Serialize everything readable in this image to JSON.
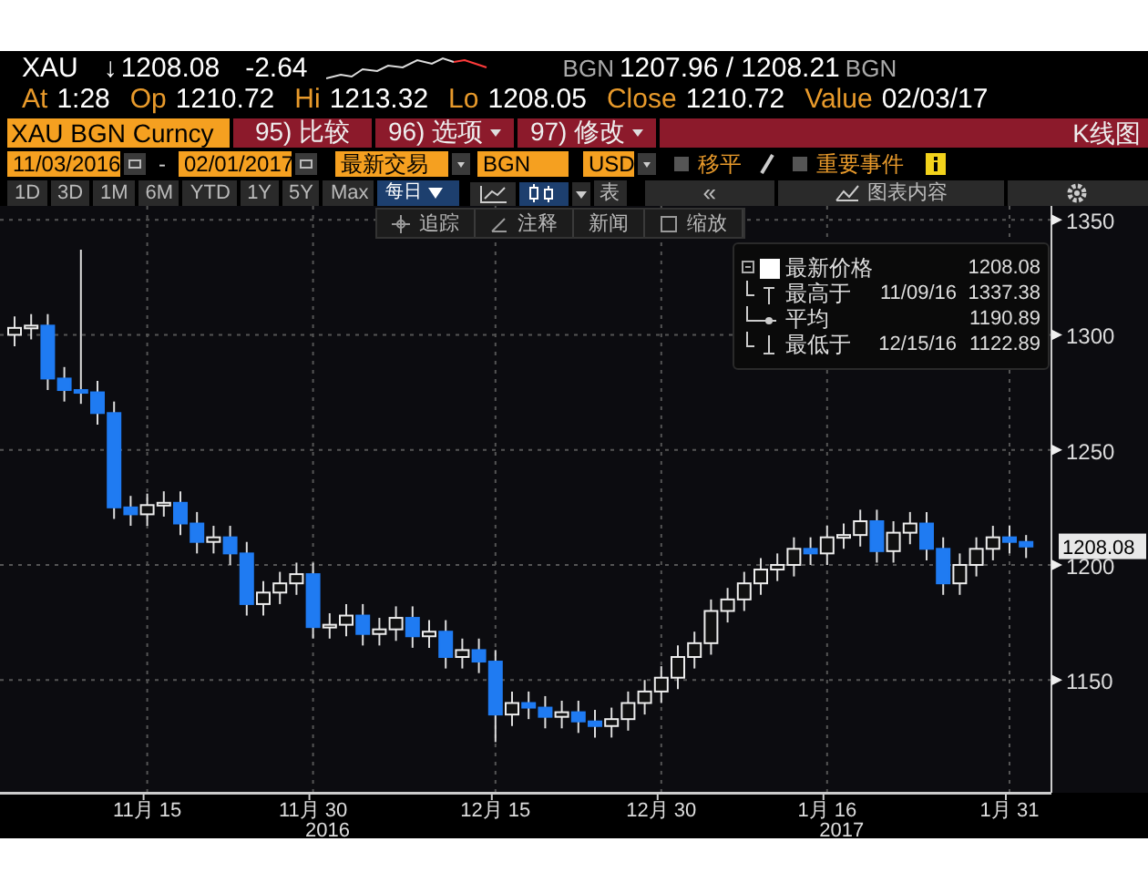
{
  "quote": {
    "ticker": "XAU",
    "arrow": "↓",
    "last": "1208.08",
    "change": "-2.64",
    "bid_source": "BGN",
    "bid_ask": "1207.96 / 1208.21",
    "ask_source": "BGN"
  },
  "stats": [
    {
      "label": "At",
      "value": "1:28"
    },
    {
      "label": "Op",
      "value": "1210.72"
    },
    {
      "label": "Hi",
      "value": "1213.32"
    },
    {
      "label": "Lo",
      "value": "1208.05"
    },
    {
      "label": "Close",
      "value": "1210.72"
    },
    {
      "label": "Value",
      "value": "02/03/17"
    }
  ],
  "command_bar": {
    "security": "XAU BGN Curncy",
    "buttons": [
      {
        "label": "95) 比较",
        "dropdown": false
      },
      {
        "label": "96) 选项",
        "dropdown": true
      },
      {
        "label": "97) 修改",
        "dropdown": true
      }
    ],
    "title": "K线图"
  },
  "settings_bar": {
    "start_date": "11/03/2016",
    "separator": "-",
    "end_date": "02/01/2017",
    "field": "最新交易",
    "source": "BGN",
    "currency": "USD",
    "toggles": [
      {
        "label": "移平",
        "checked": false
      },
      {
        "label": "重要事件",
        "checked": false
      }
    ]
  },
  "period_buttons": [
    "1D",
    "3D",
    "1M",
    "6M",
    "YTD",
    "1Y",
    "5Y",
    "Max"
  ],
  "frequency": "每日",
  "table_button": "表",
  "collapse_button": "«",
  "chart_contents_button": "图表内容",
  "chart_tools": [
    {
      "kind": "track",
      "label": "追踪"
    },
    {
      "kind": "annotate",
      "label": "注释"
    },
    {
      "kind": "news",
      "label": "新闻"
    },
    {
      "kind": "zoom",
      "label": "缩放"
    }
  ],
  "legend": [
    {
      "kind": "last",
      "label": "最新价格",
      "value": "1208.08"
    },
    {
      "kind": "high",
      "label": "最高于",
      "date": "11/09/16",
      "value": "1337.38"
    },
    {
      "kind": "average",
      "label": "平均",
      "value": "1190.89"
    },
    {
      "kind": "low",
      "label": "最低于",
      "date": "12/15/16",
      "value": "1122.89"
    }
  ],
  "chart": {
    "last_price_tag": "1208.08",
    "year_labels": [
      "2016",
      "2017"
    ],
    "chart_data": {
      "type": "candlestick",
      "grid": true,
      "ylim": [
        1101,
        1356
      ],
      "yticks": [
        1150,
        1200,
        1250,
        1300,
        1350
      ],
      "categories": [
        null,
        null,
        null,
        null,
        null,
        null,
        null,
        null,
        "11月 15",
        null,
        null,
        null,
        null,
        null,
        null,
        null,
        null,
        null,
        "11月 30",
        null,
        null,
        null,
        null,
        null,
        null,
        null,
        null,
        null,
        null,
        "12月 15",
        null,
        null,
        null,
        null,
        null,
        null,
        null,
        null,
        null,
        "12月 30",
        null,
        null,
        null,
        null,
        null,
        null,
        null,
        null,
        null,
        "1月 16",
        null,
        null,
        null,
        null,
        null,
        null,
        null,
        null,
        null,
        null,
        "1月 31",
        null
      ],
      "ohlc": [
        [
          1300,
          1308,
          1295,
          1303
        ],
        [
          1303,
          1309,
          1298,
          1304
        ],
        [
          1304,
          1309,
          1276,
          1281
        ],
        [
          1281,
          1286,
          1271,
          1276
        ],
        [
          1276,
          1337,
          1270,
          1275
        ],
        [
          1275,
          1280,
          1261,
          1266
        ],
        [
          1266,
          1271,
          1220,
          1225
        ],
        [
          1225,
          1230,
          1217,
          1222
        ],
        [
          1222,
          1231,
          1217,
          1226
        ],
        [
          1226,
          1232,
          1221,
          1227
        ],
        [
          1227,
          1232,
          1213,
          1218
        ],
        [
          1218,
          1223,
          1205,
          1210
        ],
        [
          1210,
          1217,
          1205,
          1212
        ],
        [
          1212,
          1217,
          1200,
          1205
        ],
        [
          1205,
          1210,
          1178,
          1183
        ],
        [
          1183,
          1193,
          1178,
          1188
        ],
        [
          1188,
          1197,
          1183,
          1192
        ],
        [
          1192,
          1201,
          1187,
          1196
        ],
        [
          1196,
          1201,
          1168,
          1173
        ],
        [
          1173,
          1179,
          1168,
          1174
        ],
        [
          1174,
          1183,
          1169,
          1178
        ],
        [
          1178,
          1183,
          1165,
          1170
        ],
        [
          1170,
          1177,
          1165,
          1172
        ],
        [
          1172,
          1182,
          1167,
          1177
        ],
        [
          1177,
          1182,
          1164,
          1169
        ],
        [
          1169,
          1176,
          1164,
          1171
        ],
        [
          1171,
          1176,
          1155,
          1160
        ],
        [
          1160,
          1168,
          1155,
          1163
        ],
        [
          1163,
          1168,
          1153,
          1158
        ],
        [
          1158,
          1163,
          1123,
          1135
        ],
        [
          1135,
          1145,
          1130,
          1140
        ],
        [
          1140,
          1145,
          1133,
          1138
        ],
        [
          1138,
          1143,
          1129,
          1134
        ],
        [
          1134,
          1141,
          1129,
          1136
        ],
        [
          1136,
          1141,
          1127,
          1132
        ],
        [
          1132,
          1137,
          1125,
          1130
        ],
        [
          1130,
          1138,
          1125,
          1133
        ],
        [
          1133,
          1145,
          1128,
          1140
        ],
        [
          1140,
          1150,
          1135,
          1145
        ],
        [
          1145,
          1156,
          1140,
          1151
        ],
        [
          1151,
          1165,
          1146,
          1160
        ],
        [
          1160,
          1171,
          1155,
          1166
        ],
        [
          1166,
          1185,
          1161,
          1180
        ],
        [
          1180,
          1190,
          1175,
          1185
        ],
        [
          1185,
          1197,
          1180,
          1192
        ],
        [
          1192,
          1203,
          1187,
          1198
        ],
        [
          1198,
          1205,
          1193,
          1200
        ],
        [
          1200,
          1212,
          1195,
          1207
        ],
        [
          1207,
          1212,
          1200,
          1205
        ],
        [
          1205,
          1217,
          1200,
          1212
        ],
        [
          1212,
          1218,
          1207,
          1213
        ],
        [
          1213,
          1224,
          1208,
          1219
        ],
        [
          1219,
          1224,
          1201,
          1206
        ],
        [
          1206,
          1219,
          1201,
          1214
        ],
        [
          1214,
          1223,
          1209,
          1218
        ],
        [
          1218,
          1223,
          1202,
          1207
        ],
        [
          1207,
          1212,
          1187,
          1192
        ],
        [
          1192,
          1205,
          1187,
          1200
        ],
        [
          1200,
          1212,
          1195,
          1207
        ],
        [
          1207,
          1217,
          1202,
          1212
        ],
        [
          1212,
          1217,
          1205,
          1210
        ],
        [
          1210,
          1213,
          1203,
          1208
        ]
      ]
    }
  }
}
